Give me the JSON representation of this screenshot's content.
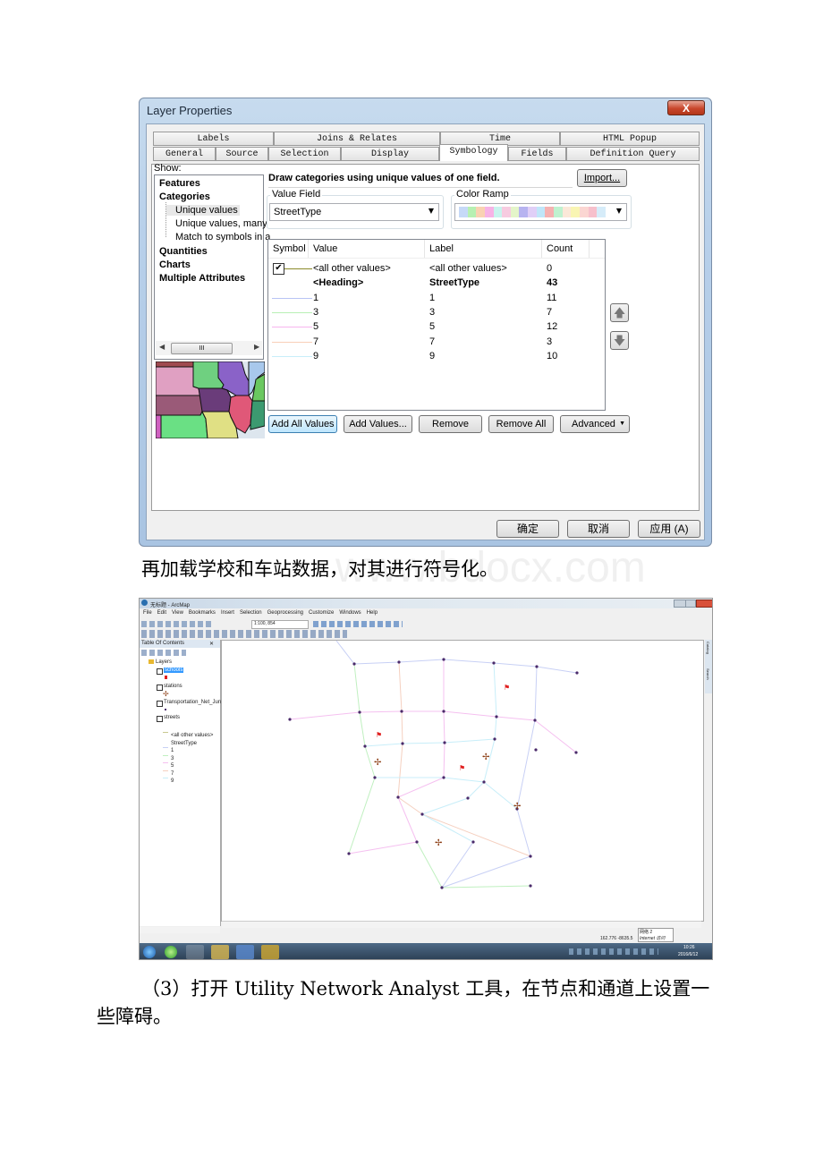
{
  "dialog": {
    "title": "Layer Properties",
    "close_label": "X",
    "tabs_row1": [
      "Labels",
      "Joins & Relates",
      "Time",
      "HTML Popup"
    ],
    "tabs_row2": [
      "General",
      "Source",
      "Selection",
      "Display",
      "Symbology",
      "Fields",
      "Definition Query"
    ],
    "active_tab": "Symbology",
    "show_label": "Show:",
    "tree": {
      "features": "Features",
      "categories": "Categories",
      "cat_items": [
        "Unique values",
        "Unique values, many",
        "Match to symbols in a"
      ],
      "quantities": "Quantities",
      "charts": "Charts",
      "multiple": "Multiple Attributes"
    },
    "scroll_thumb": "III",
    "heading": "Draw categories using unique values of one field.",
    "import_label": "Import...",
    "value_field_label": "Value Field",
    "value_field_value": "StreetType",
    "color_ramp_label": "Color Ramp",
    "color_ramp_colors": [
      "#c6d9f7",
      "#b7f0b2",
      "#f9d2b3",
      "#f7b3e6",
      "#c9f3ee",
      "#f7cbe0",
      "#e4f5c9",
      "#b7b3f0",
      "#e0cff7",
      "#c0e6f9",
      "#f5b2b2",
      "#bff2cf",
      "#fbe8d8",
      "#f9f5b3",
      "#fbd6d2",
      "#f7c0cc",
      "#d6ecf9"
    ],
    "table": {
      "headers": [
        "Symbol",
        "Value",
        "Label",
        "Count"
      ],
      "rows": [
        {
          "color": "#8b8a2a",
          "value": "<all other values>",
          "label": "<all other values>",
          "count": "0",
          "checked": true
        },
        {
          "color": "",
          "value": "<Heading>",
          "label": "StreetType",
          "count": "43",
          "bold": true
        },
        {
          "color": "#b8c4f5",
          "value": "1",
          "label": "1",
          "count": "11"
        },
        {
          "color": "#b8f0b5",
          "value": "3",
          "label": "3",
          "count": "7"
        },
        {
          "color": "#f7b5ee",
          "value": "5",
          "label": "5",
          "count": "12"
        },
        {
          "color": "#f9cfb8",
          "value": "7",
          "label": "7",
          "count": "3"
        },
        {
          "color": "#c8eef9",
          "value": "9",
          "label": "9",
          "count": "10"
        }
      ]
    },
    "buttons": {
      "add_all": "Add All Values",
      "add_values": "Add Values...",
      "remove": "Remove",
      "remove_all": "Remove All",
      "advanced": "Advanced"
    },
    "footer": {
      "ok": "确定",
      "cancel": "取消",
      "apply": "应用 (A)"
    }
  },
  "paragraph1": "再加载学校和车站数据，对其进行符号化。",
  "watermark": "www.bdocx.com",
  "arcmap": {
    "title": "无标题 - ArcMap",
    "menu": [
      "File",
      "Edit",
      "View",
      "Bookmarks",
      "Insert",
      "Selection",
      "Geoprocessing",
      "Customize",
      "Windows",
      "Help"
    ],
    "scale": "1:100, 854",
    "toc_title": "Table Of Contents",
    "toc": {
      "root": "Layers",
      "layers": [
        "schools",
        "stations",
        "Transportation_Net_Jun",
        "streets"
      ],
      "streets_items": [
        "<all other values>",
        "StreetType",
        "1",
        "3",
        "5",
        "7",
        "9"
      ]
    },
    "side_tabs": [
      "Catalog",
      "Search"
    ],
    "coords": "162.776  -8635.5",
    "tooltip_line1": "网络 2",
    "tooltip_line2": "Internet 访问",
    "clock_time": "10:26",
    "clock_date": "2016/6/12"
  },
  "paragraph2_line1": "（3）打开 Utility Network Analyst 工具，在节点和通道上设置一",
  "paragraph2_line2": "些障碍。"
}
